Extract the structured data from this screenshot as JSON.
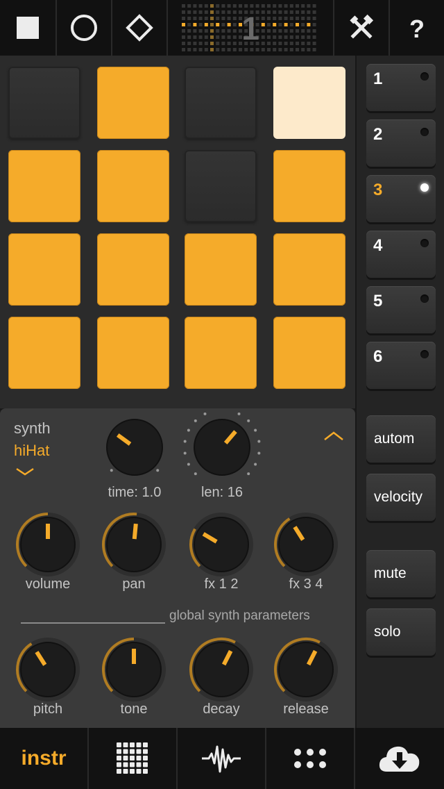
{
  "toolbar": {
    "stop_icon": "stop-icon",
    "record_icon": "record-icon",
    "loop_icon": "diamond-icon",
    "pattern_number": "1",
    "tools_icon": "tools-icon",
    "help_icon": "help-icon"
  },
  "pads": [
    {
      "row": 1,
      "col": 1,
      "state": "off"
    },
    {
      "row": 1,
      "col": 2,
      "state": "on"
    },
    {
      "row": 1,
      "col": 3,
      "state": "off"
    },
    {
      "row": 1,
      "col": 4,
      "state": "playing"
    },
    {
      "row": 2,
      "col": 1,
      "state": "on"
    },
    {
      "row": 2,
      "col": 2,
      "state": "on"
    },
    {
      "row": 2,
      "col": 3,
      "state": "off"
    },
    {
      "row": 2,
      "col": 4,
      "state": "on"
    },
    {
      "row": 3,
      "col": 1,
      "state": "on"
    },
    {
      "row": 3,
      "col": 2,
      "state": "on"
    },
    {
      "row": 3,
      "col": 3,
      "state": "on"
    },
    {
      "row": 3,
      "col": 4,
      "state": "on"
    },
    {
      "row": 4,
      "col": 1,
      "state": "on"
    },
    {
      "row": 4,
      "col": 2,
      "state": "on"
    },
    {
      "row": 4,
      "col": 3,
      "state": "on"
    },
    {
      "row": 4,
      "col": 4,
      "state": "on"
    }
  ],
  "tracks": [
    {
      "label": "1",
      "selected": false
    },
    {
      "label": "2",
      "selected": false
    },
    {
      "label": "3",
      "selected": true
    },
    {
      "label": "4",
      "selected": false
    },
    {
      "label": "5",
      "selected": false
    },
    {
      "label": "6",
      "selected": false
    }
  ],
  "side_buttons": {
    "autom": "autom",
    "velocity": "velocity",
    "mute": "mute",
    "solo": "solo"
  },
  "synth": {
    "label": "synth",
    "name": "hiHat",
    "time_label": "time: 1.0",
    "len_label": "len: 16",
    "knobs": {
      "volume": {
        "label": "volume",
        "value": 0.5
      },
      "pan": {
        "label": "pan",
        "value": 0.52
      },
      "fx12": {
        "label": "fx 1 2",
        "value": 0.28
      },
      "fx34": {
        "label": "fx 3 4",
        "value": 0.38
      },
      "pitch": {
        "label": "pitch",
        "value": 0.38
      },
      "tone": {
        "label": "tone",
        "value": 0.5
      },
      "decay": {
        "label": "decay",
        "value": 0.6
      },
      "release": {
        "label": "release",
        "value": 0.6
      }
    },
    "global_label": "global synth parameters"
  },
  "tabs": {
    "instr": "instr"
  },
  "colors": {
    "accent": "#f5ab2a",
    "pad_playing": "#fdeacb",
    "background": "#2b2b2b"
  }
}
